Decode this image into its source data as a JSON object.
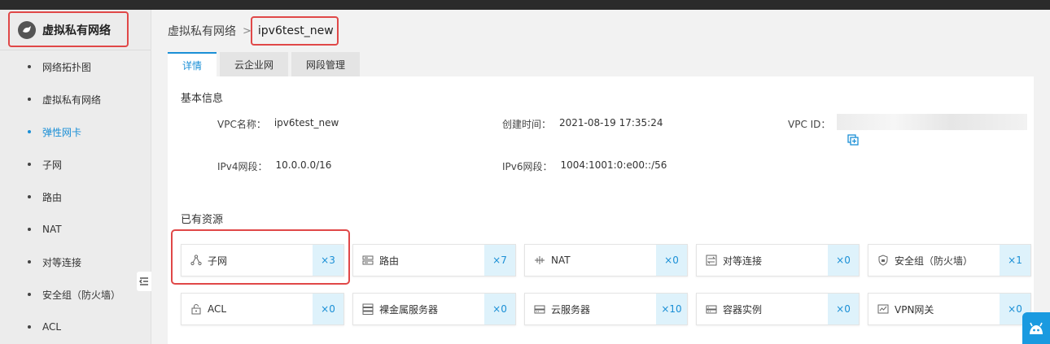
{
  "sidebar": {
    "title": "虚拟私有网络",
    "items": [
      {
        "label": "网络拓扑图",
        "active": false
      },
      {
        "label": "虚拟私有网络",
        "active": false
      },
      {
        "label": "弹性网卡",
        "active": true
      },
      {
        "label": "子网",
        "active": false
      },
      {
        "label": "路由",
        "active": false
      },
      {
        "label": "NAT",
        "active": false
      },
      {
        "label": "对等连接",
        "active": false
      },
      {
        "label": "安全组（防火墙）",
        "active": false
      },
      {
        "label": "ACL",
        "active": false
      }
    ]
  },
  "breadcrumb": {
    "root": "虚拟私有网络",
    "separator": ">",
    "current": "ipv6test_new"
  },
  "tabs": [
    {
      "label": "详情",
      "active": true
    },
    {
      "label": "云企业网",
      "active": false
    },
    {
      "label": "网段管理",
      "active": false
    }
  ],
  "basic_info": {
    "title": "基本信息",
    "vpc_name_label": "VPC名称：",
    "vpc_name": "ipv6test_new",
    "created_label": "创建时间：",
    "created": "2021-08-19 17:35:24",
    "vpc_id_label": "VPC ID：",
    "ipv4_label": "IPv4网段：",
    "ipv4": "10.0.0.0/16",
    "ipv6_label": "IPv6网段：",
    "ipv6": "1004:1001:0:e00::/56"
  },
  "resources": {
    "title": "已有资源",
    "items": [
      {
        "label": "子网",
        "count": "×3",
        "icon": "subnet-icon"
      },
      {
        "label": "路由",
        "count": "×7",
        "icon": "route-icon"
      },
      {
        "label": "NAT",
        "count": "×0",
        "icon": "nat-icon"
      },
      {
        "label": "对等连接",
        "count": "×0",
        "icon": "peering-icon"
      },
      {
        "label": "安全组（防火墙）",
        "count": "×1",
        "icon": "shield-icon"
      },
      {
        "label": "ACL",
        "count": "×0",
        "icon": "lock-icon"
      },
      {
        "label": "裸金属服务器",
        "count": "×0",
        "icon": "baremetal-server-icon"
      },
      {
        "label": "云服务器",
        "count": "×10",
        "icon": "cloud-server-icon"
      },
      {
        "label": "容器实例",
        "count": "×0",
        "icon": "container-icon"
      },
      {
        "label": "VPN网关",
        "count": "×0",
        "icon": "vpn-gateway-icon"
      }
    ]
  },
  "colors": {
    "accent": "#1a8fd6",
    "highlight": "#e04848",
    "count_bg": "#def2fb"
  }
}
